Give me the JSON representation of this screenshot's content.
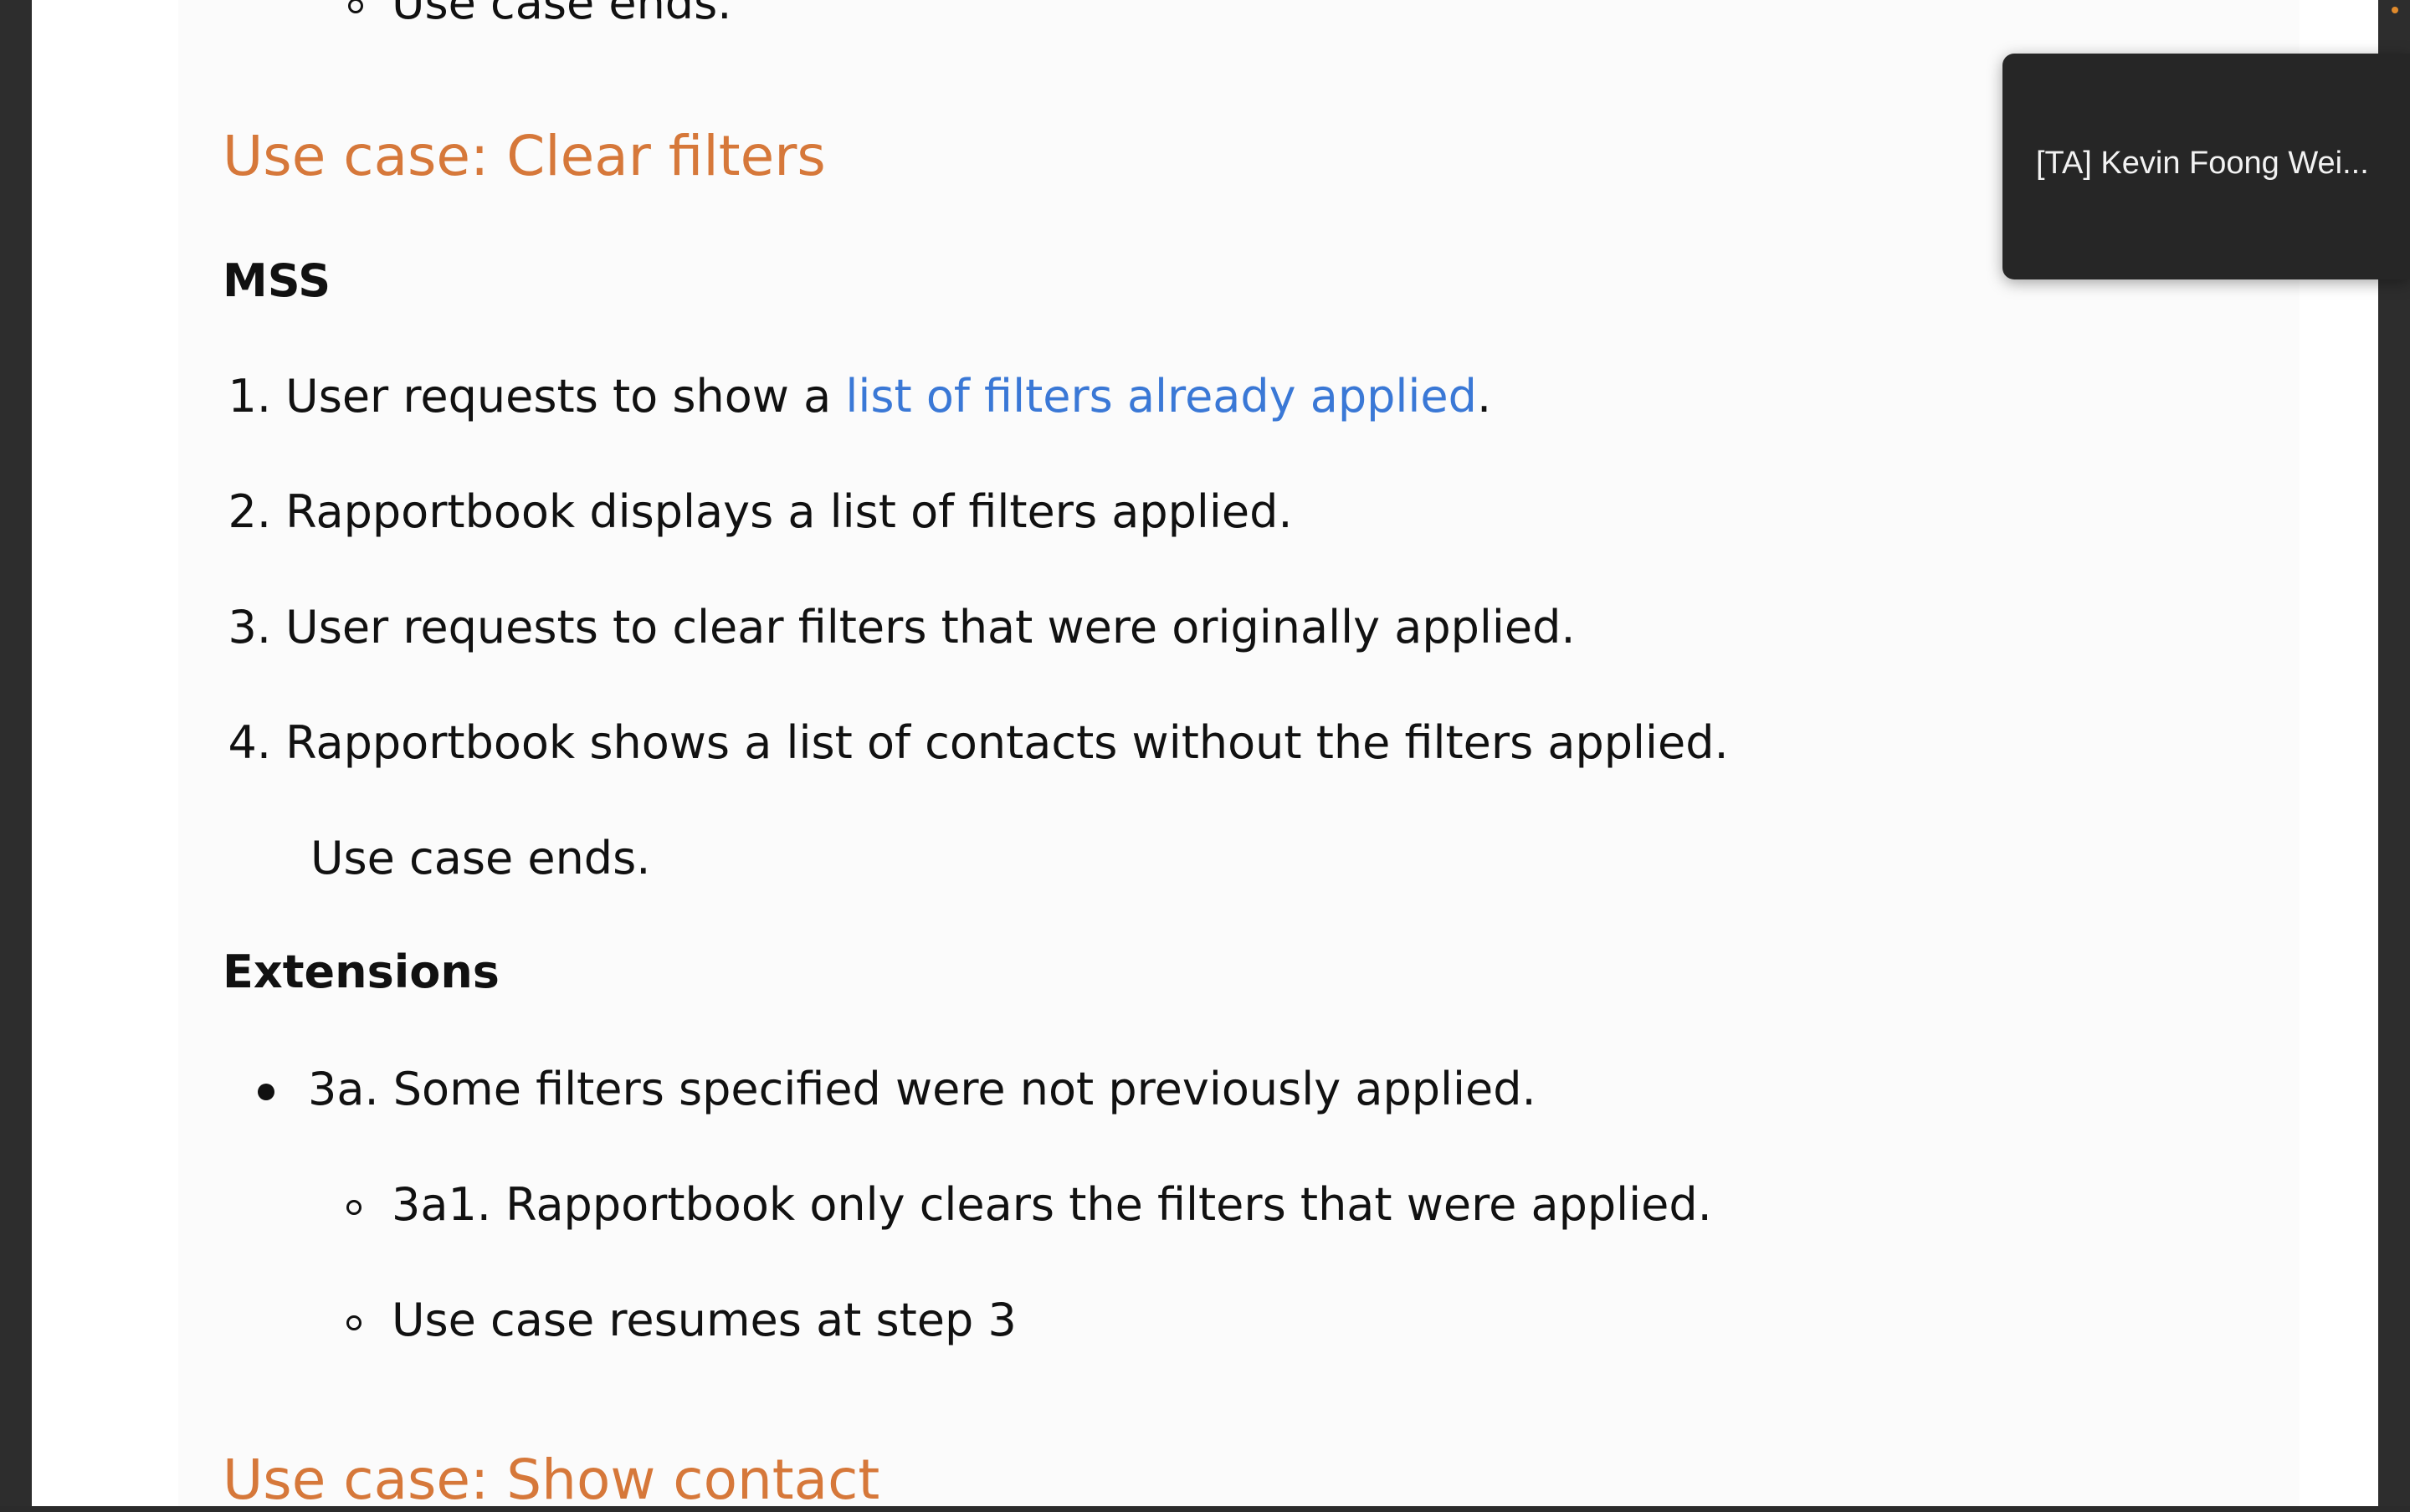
{
  "document": {
    "prev_section_tail": "Use case ends.",
    "section": {
      "title": "Use case: Clear filters",
      "mss_label": "MSS",
      "steps": [
        {
          "number": "1.",
          "before": "User requests to show a ",
          "link": "list of filters already applied",
          "after": "."
        },
        {
          "number": "2.",
          "text": "Rapportbook displays a list of filters applied."
        },
        {
          "number": "3.",
          "text": "User requests to clear filters that were originally applied."
        },
        {
          "number": "4.",
          "text": "Rapportbook shows a list of contacts without the filters applied."
        }
      ],
      "end_note": "Use case ends.",
      "extensions_label": "Extensions",
      "extensions": [
        {
          "text": "3a. Some filters specified were not previously applied.",
          "subitems": [
            "3a1. Rapportbook only clears the filters that were applied.",
            "Use case resumes at step 3"
          ]
        }
      ]
    },
    "next_section_title": "Use case: Show contact"
  },
  "notification": {
    "participant_name": "[TA] Kevin Foong Wei..."
  },
  "colors": {
    "heading": "#d6783a",
    "link": "#3a78d6",
    "notification_bg": "#262626"
  }
}
